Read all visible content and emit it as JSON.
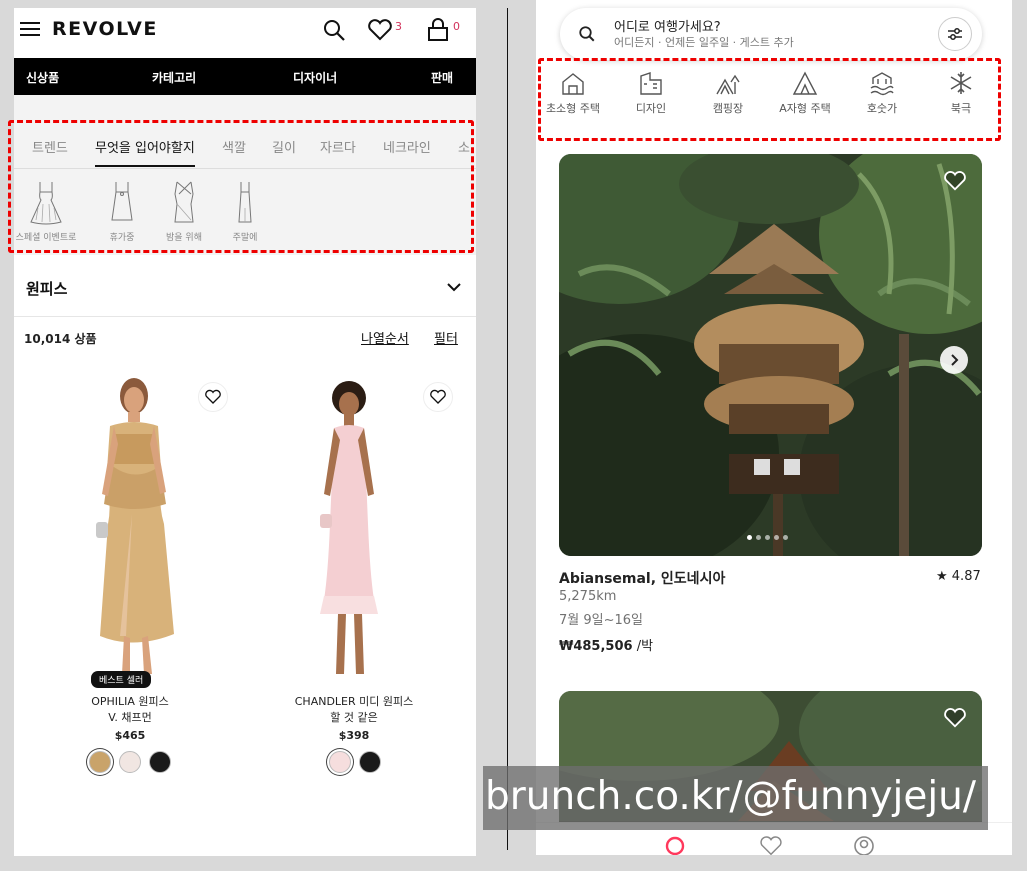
{
  "left": {
    "brand": "REVOLVE",
    "wishlist_count": "3",
    "cart_count": "0",
    "nav": [
      "신상품",
      "카테고리",
      "디자이너",
      "판매"
    ],
    "tabs": [
      "트렌드",
      "무엇을 입어야할지",
      "색깔",
      "길이",
      "자르다",
      "네크라인",
      "소"
    ],
    "styles": [
      "스페셜 이벤트로",
      "휴가중",
      "밤을 위해",
      "주말에"
    ],
    "section_title": "원피스",
    "count": "10,014 상품",
    "sort_label": "나열순서",
    "filter_label": "필터",
    "products": [
      {
        "badge": "베스트 셀러",
        "name1": "OPHILIA 원피스",
        "name2": "V. 채프먼",
        "price": "$465",
        "swatches": [
          "#c9a36a",
          "#f1e6e2",
          "#1a1a1a"
        ]
      },
      {
        "badge": "",
        "name1": "CHANDLER 미디 원피스",
        "name2": "할 것 같은",
        "price": "$398",
        "swatches": [
          "#f6dede",
          "#1a1a1a"
        ]
      }
    ]
  },
  "right": {
    "search_title": "어디로 여행가세요?",
    "search_sub": "어디든지 · 언제든 일주일 · 게스트 추가",
    "categories": [
      {
        "label": "초소형 주택",
        "icon": "tiny-house-icon"
      },
      {
        "label": "디자인",
        "icon": "design-icon"
      },
      {
        "label": "캠핑장",
        "icon": "camping-icon"
      },
      {
        "label": "A자형 주택",
        "icon": "a-frame-icon"
      },
      {
        "label": "호숫가",
        "icon": "lake-icon"
      },
      {
        "label": "북극",
        "icon": "snowflake-icon"
      }
    ],
    "listing": {
      "location": "Abiansemal, 인도네시아",
      "rating": "★ 4.87",
      "distance": "5,275km",
      "dates": "7월 9일~16일",
      "price": "₩485,506",
      "per": " /박"
    }
  },
  "watermark": "brunch.co.kr/@funnyjeju/",
  "colors": {
    "highlight": "#e00000",
    "accent": "#ff385c",
    "badge": "#d2335c"
  }
}
